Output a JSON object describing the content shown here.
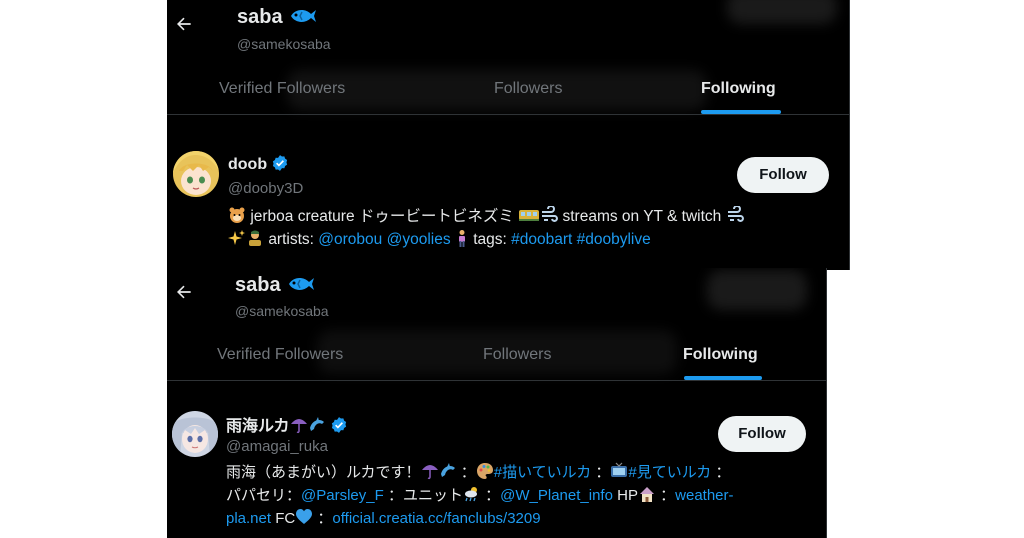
{
  "screens": [
    {
      "header": {
        "back_icon": "arrow-left-icon",
        "name": "saba",
        "name_icon": "fish-icon",
        "handle": "@samekosaba"
      },
      "tabs": [
        {
          "label": "Verified Followers",
          "active": false
        },
        {
          "label": "Followers",
          "active": false
        },
        {
          "label": "Following",
          "active": true
        }
      ],
      "user": {
        "name": "doob",
        "verified": true,
        "handle": "@dooby3D",
        "follow_label": "Follow",
        "bio": {
          "line1_a": "jerboa creature ドゥービートビネズミ",
          "line1_b": "streams on YT & twitch",
          "line2_a": "artists:",
          "mention1": "@orobou",
          "mention2": "@yoolies",
          "line2_b": "tags:",
          "tag1": "#doobart",
          "tag2": "#doobylive"
        }
      }
    },
    {
      "header": {
        "back_icon": "arrow-left-icon",
        "name": "saba",
        "name_icon": "fish-icon",
        "handle": "@samekosaba"
      },
      "tabs": [
        {
          "label": "Verified Followers",
          "active": false
        },
        {
          "label": "Followers",
          "active": false
        },
        {
          "label": "Following",
          "active": true
        }
      ],
      "user": {
        "name": "雨海ルカ",
        "verified": true,
        "handle": "@amagai_ruka",
        "follow_label": "Follow",
        "bio": {
          "l1_a": "雨海（あまがい）ルカです！",
          "l1_b": "：",
          "l1_link1": "#描いていルカ",
          "l1_c": "：",
          "l1_link2": "#見ていルカ",
          "l1_d": "：",
          "l2_a": "パパセリ：",
          "l2_link1": "@Parsley_F",
          "l2_b": "：ユニット",
          "l2_c": "：",
          "l2_link2": "@W_Planet_info",
          "l2_d": "HP",
          "l2_e": "：",
          "l2_link3": "weather-",
          "l3_link1": "pla.net",
          "l3_a": "FC",
          "l3_b": "：",
          "l3_link2": "official.creatia.cc/fanclubs/3209"
        }
      }
    }
  ]
}
